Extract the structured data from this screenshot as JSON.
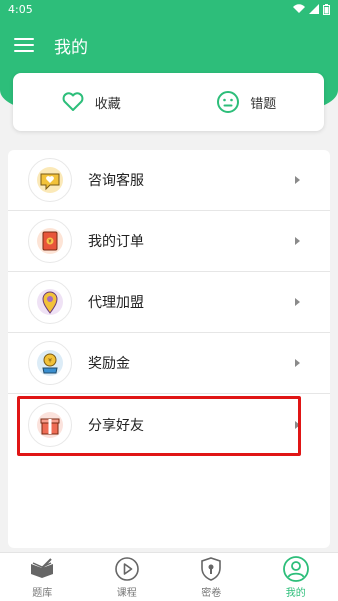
{
  "status_bar": {
    "time": "4:05"
  },
  "app_bar": {
    "title": "我的",
    "menu_icon": "hamburger-menu-icon"
  },
  "quick_actions": [
    {
      "label": "收藏",
      "icon": "heart-icon"
    },
    {
      "label": "错题",
      "icon": "neutral-face-icon"
    }
  ],
  "menu": [
    {
      "label": "咨询客服",
      "icon": "chat-heart-icon"
    },
    {
      "label": "我的订单",
      "icon": "red-envelope-icon"
    },
    {
      "label": "代理加盟",
      "icon": "location-pin-icon"
    },
    {
      "label": "奖励金",
      "icon": "money-jar-icon"
    },
    {
      "label": "分享好友",
      "icon": "gift-box-icon"
    }
  ],
  "bottom_nav": [
    {
      "label": "题库",
      "icon": "book-icon",
      "active": false
    },
    {
      "label": "课程",
      "icon": "play-circle-icon",
      "active": false
    },
    {
      "label": "密卷",
      "icon": "keyhole-shield-icon",
      "active": false
    },
    {
      "label": "我的",
      "icon": "user-circle-icon",
      "active": true
    }
  ],
  "colors": {
    "accent": "#2dbe7a",
    "highlight": "#e01515"
  }
}
